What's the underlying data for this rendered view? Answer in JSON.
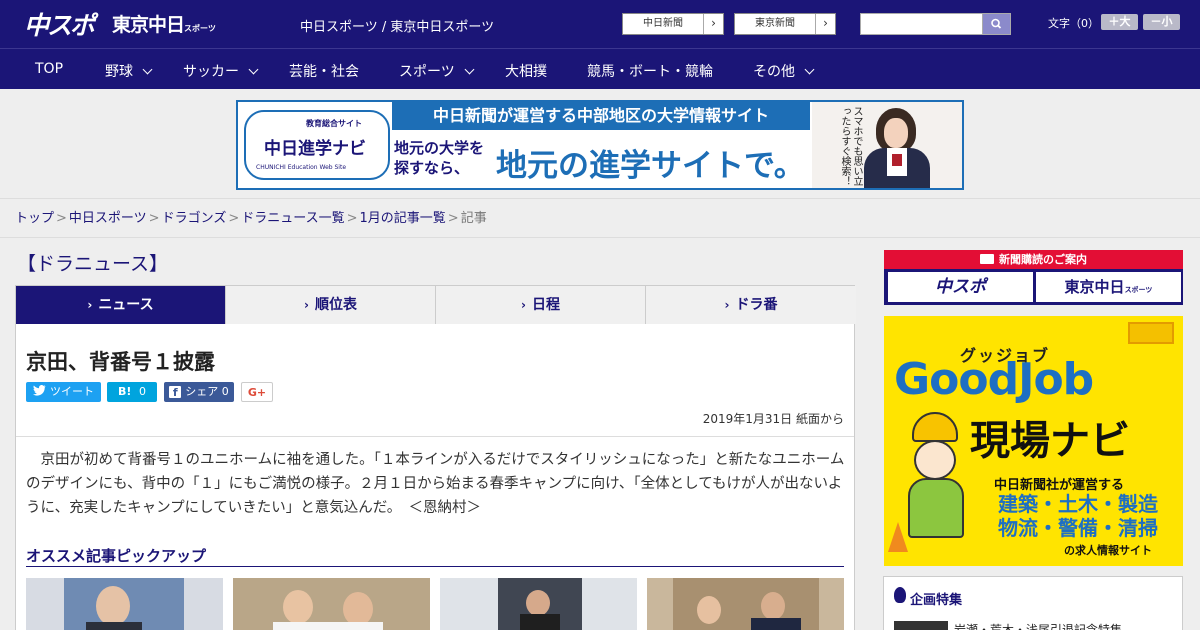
{
  "header": {
    "logo_chuspo": "中スポ",
    "logo_tokyo": "東京中日",
    "logo_tokyo_small": "スポーツ",
    "site_name": "中日スポーツ / 東京中日スポーツ",
    "links": [
      "中日新聞",
      "東京新聞"
    ],
    "font_size_label": "文字（0）",
    "font_plus": "＋大",
    "font_minus": "－小",
    "search_placeholder": ""
  },
  "nav": {
    "items": [
      {
        "label": "TOP",
        "dropdown": false
      },
      {
        "label": "野球",
        "dropdown": true
      },
      {
        "label": "サッカー",
        "dropdown": true
      },
      {
        "label": "芸能・社会",
        "dropdown": false
      },
      {
        "label": "スポーツ",
        "dropdown": true
      },
      {
        "label": "大相撲",
        "dropdown": false
      },
      {
        "label": "競馬・ボート・競輪",
        "dropdown": false
      },
      {
        "label": "その他",
        "dropdown": true
      }
    ]
  },
  "banner": {
    "logo_top": "教育総合サイト",
    "logo_main": "中日進学ナビ",
    "logo_sub": "CHUNICHI Education Web Site",
    "headline": "中日新聞が運営する中部地区の大学情報サイト",
    "left_text": "地元の大学を探すなら、",
    "big_text": "地元の進学サイトで。",
    "small_text": "スマホでも思い立ったらすぐ検索！"
  },
  "breadcrumb": {
    "links": [
      "トップ",
      "中日スポーツ",
      "ドラゴンズ",
      "ドラニュース一覧",
      "1月の記事一覧"
    ],
    "current": "記事",
    "separator": ">"
  },
  "section_title": "【ドラニュース】",
  "tabs": [
    "ニュース",
    "順位表",
    "日程",
    "ドラ番"
  ],
  "active_tab": 0,
  "article": {
    "title": "京田、背番号１披露",
    "share": {
      "tweet": "ツイート",
      "hatena": "B!",
      "hatena_count": "0",
      "facebook": "シェア",
      "facebook_count": "0",
      "gplus": "G+"
    },
    "date": "2019年1月31日 紙面から",
    "body": "京田が初めて背番号１のユニホームに袖を通した。「１本ラインが入るだけでスタイリッシュになった」と新たなユニホームのデザインにも、背中の「１」にもご満悦の様子。２月１日から始まる春季キャンプに向け、「全体としてもけが人が出ないように、充実したキャンプにしていきたい」と意気込んだ。　＜恩納村＞",
    "pickup_title": "オススメ記事ピックアップ"
  },
  "sidebar": {
    "ad1_title": "新聞購読のご案内",
    "ad1_items": [
      "中スポ",
      "東京中日"
    ],
    "ad1_small": "スポーツ",
    "ad2_small": "グッジョブ",
    "ad2_title": "GoodJob",
    "ad2_subtitle": "現場ナビ",
    "ad2_line1": "中日新聞社が運営する",
    "ad2_line2": "建築・土木・製造",
    "ad2_line3": "物流・警備・清掃",
    "ad2_line4": "の求人情報サイト",
    "feature_title": "企画特集",
    "feature_item": "岩瀬・荒木・浅尾引退記念特集"
  },
  "colors": {
    "brand_navy": "#1b1577",
    "banner_blue": "#1d6eb6",
    "twitter": "#1da1f2",
    "hatena": "#00a4de",
    "facebook": "#3b5998",
    "ad_red": "#e30e35",
    "ad_yellow": "#ffe400"
  }
}
